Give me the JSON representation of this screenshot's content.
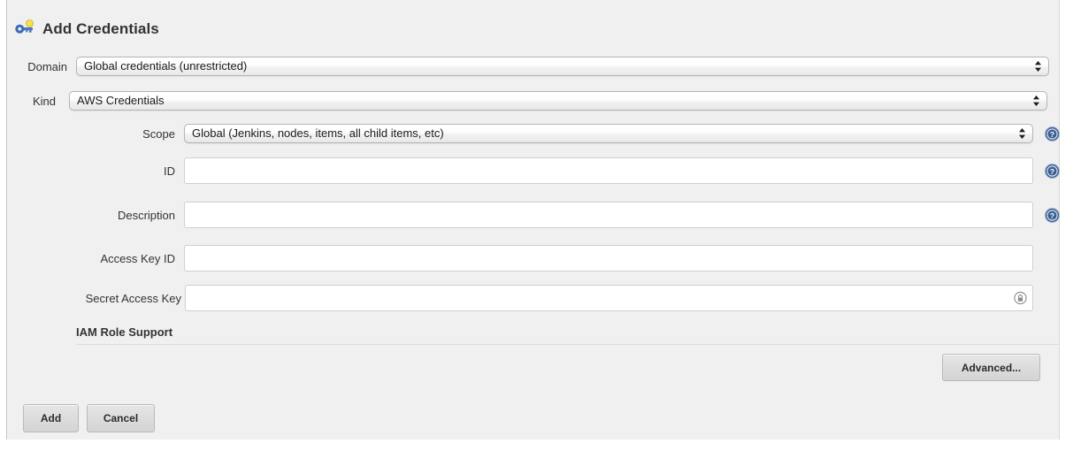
{
  "header": {
    "title": "Add Credentials",
    "icon": "key-icon"
  },
  "form": {
    "domain": {
      "label": "Domain",
      "value": "Global credentials (unrestricted)",
      "icon": "chevron-updown-icon"
    },
    "kind": {
      "label": "Kind",
      "value": "AWS Credentials",
      "icon": "chevron-updown-icon"
    },
    "scope": {
      "label": "Scope",
      "value": "Global (Jenkins, nodes, items, all child items, etc)",
      "icon": "chevron-updown-icon",
      "help": "help-icon"
    },
    "id": {
      "label": "ID",
      "value": "",
      "placeholder": "",
      "help": "help-icon"
    },
    "description": {
      "label": "Description",
      "value": "",
      "placeholder": "",
      "help": "help-icon"
    },
    "access_key_id": {
      "label": "Access Key ID",
      "value": "",
      "placeholder": ""
    },
    "secret_access_key": {
      "label": "Secret Access Key",
      "value": "",
      "placeholder": "",
      "icon": "lock-reveal-icon"
    }
  },
  "section": {
    "iam_role_support": "IAM Role Support"
  },
  "buttons": {
    "advanced": "Advanced...",
    "add": "Add",
    "cancel": "Cancel"
  },
  "colors": {
    "panel_bg": "#f0f0f0",
    "help_blue": "#3b5f93",
    "key_blue": "#4b77be",
    "key_yellow": "#f4e04d",
    "text": "#333333"
  }
}
